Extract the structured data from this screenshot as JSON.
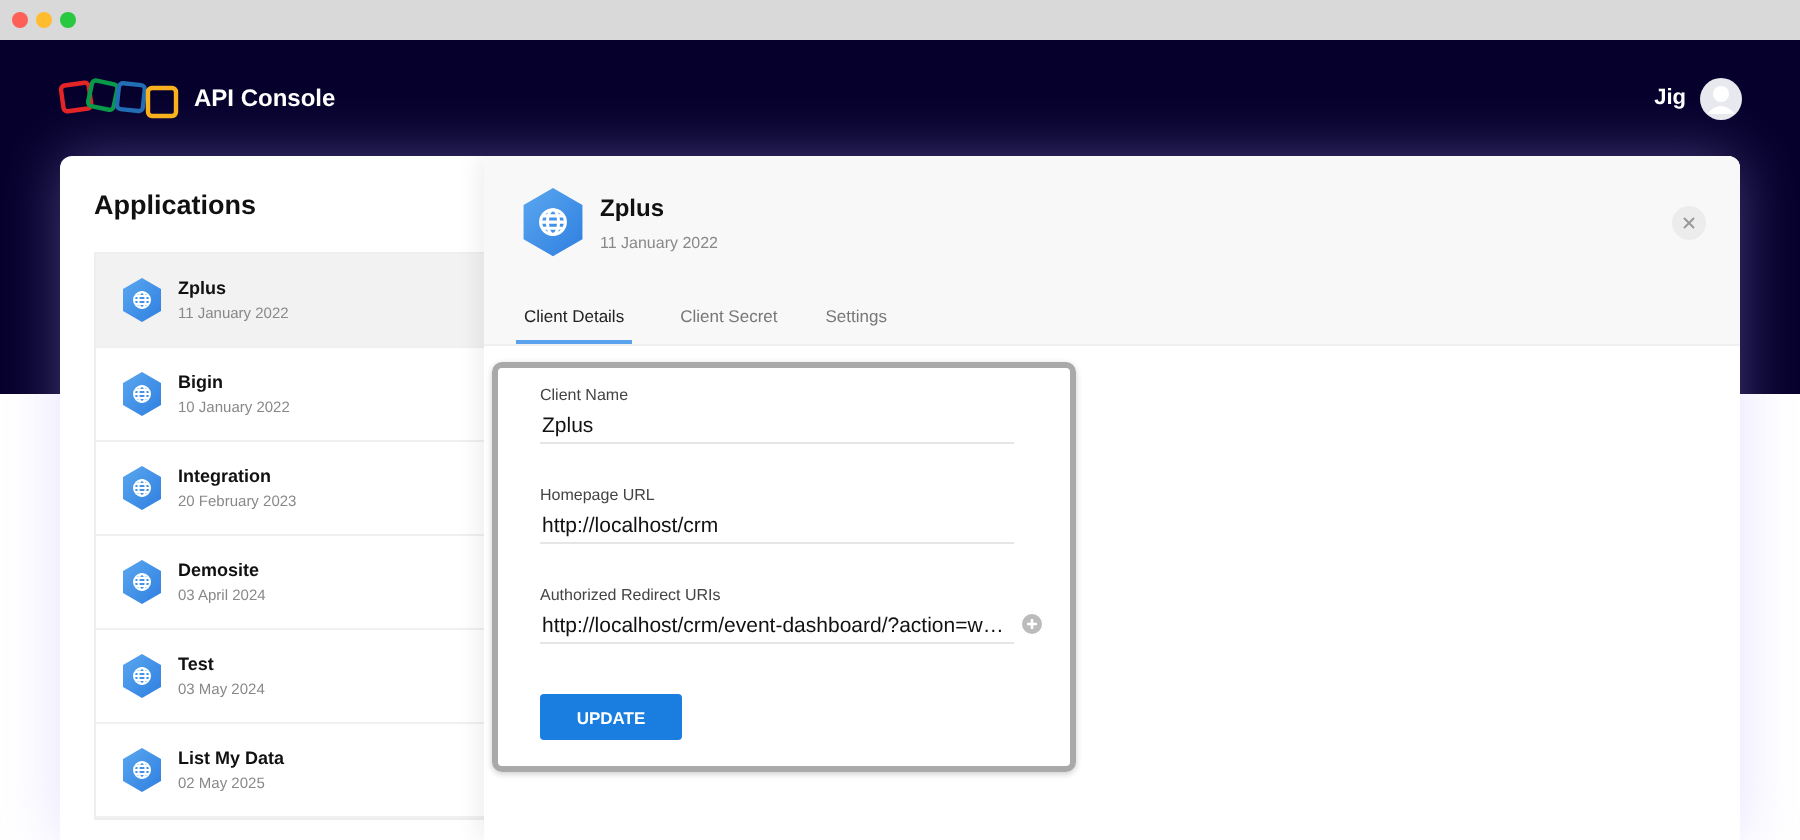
{
  "header": {
    "brand": "API Console",
    "user": "Jig"
  },
  "applications": {
    "title": "Applications",
    "items": [
      {
        "name": "Zplus",
        "date": "11 January 2022",
        "selected": true
      },
      {
        "name": "Bigin",
        "date": "10 January 2022",
        "selected": false
      },
      {
        "name": "Integration",
        "date": "20 February 2023",
        "selected": false
      },
      {
        "name": "Demosite",
        "date": "03 April 2024",
        "selected": false
      },
      {
        "name": "Test",
        "date": "03 May 2024",
        "selected": false
      },
      {
        "name": "List My Data",
        "date": "02 May 2025",
        "selected": false
      }
    ]
  },
  "detail": {
    "name": "Zplus",
    "date": "11 January 2022",
    "tabs": [
      {
        "label": "Client Details",
        "selected": true
      },
      {
        "label": "Client Secret",
        "selected": false
      },
      {
        "label": "Settings",
        "selected": false
      }
    ],
    "fields": [
      {
        "kind": "text",
        "label": "Client Name",
        "value": "Zplus"
      },
      {
        "kind": "text",
        "label": "Homepage URL",
        "value": "http://localhost/crm"
      },
      {
        "kind": "uri",
        "label": "Authorized Redirect URIs",
        "value": "http://localhost/crm/event-dashboard/?action=w…"
      }
    ],
    "button": "UPDATE"
  }
}
